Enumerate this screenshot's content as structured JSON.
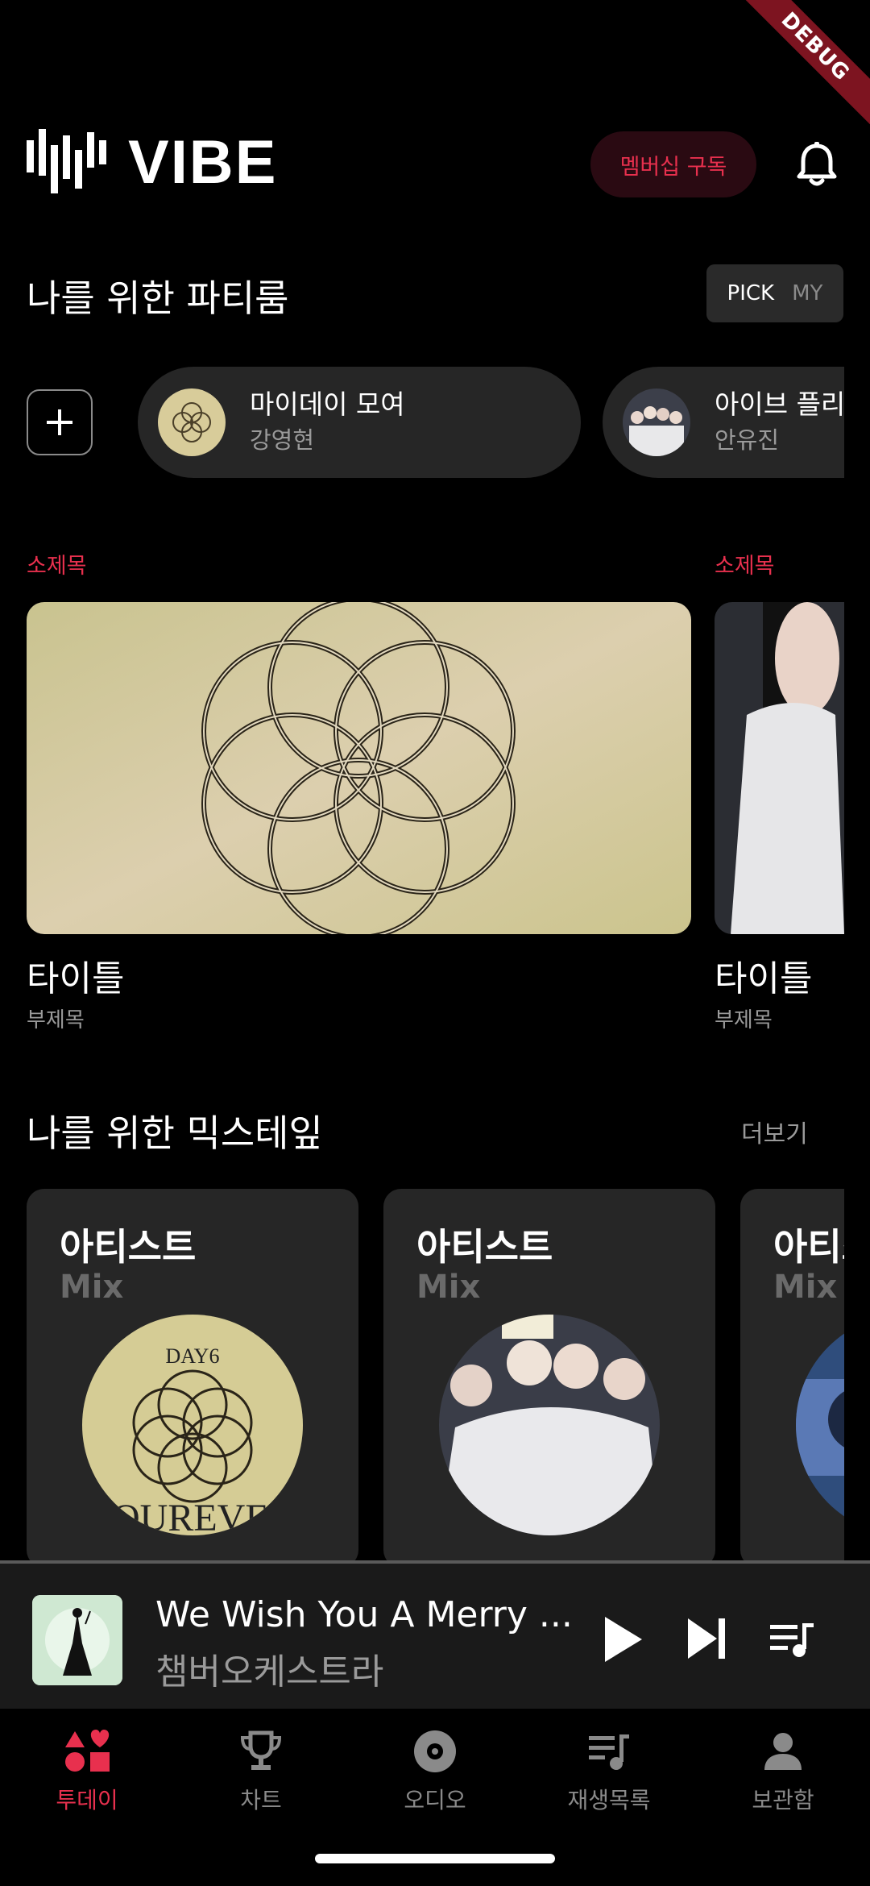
{
  "debug_badge": "DEBUG",
  "header": {
    "logo_text": "VIBE",
    "membership_button": "멤버십 구독"
  },
  "party": {
    "title": "나를 위한 파티룸",
    "toggle": {
      "pick": "PICK",
      "my": "MY"
    },
    "rooms": [
      {
        "title": "마이데이 모여",
        "host": "강영현"
      },
      {
        "title": "아이브 플리",
        "host": "안유진"
      }
    ]
  },
  "featured": [
    {
      "kicker": "소제목",
      "title": "타이틀",
      "subtitle": "부제목"
    },
    {
      "kicker": "소제목",
      "title": "타이틀",
      "subtitle": "부제목"
    }
  ],
  "mixtape": {
    "title": "나를 위한 믹스테잎",
    "more": "더보기",
    "cards": [
      {
        "artist": "아티스트",
        "label": "Mix"
      },
      {
        "artist": "아티스트",
        "label": "Mix"
      },
      {
        "artist": "아티스트",
        "label": "Mix"
      }
    ]
  },
  "album_text": {
    "day6": "DAY6",
    "fourever": "FOUREVER"
  },
  "player": {
    "song": "We Wish You A Merry ...",
    "artist": "챔버오케스트라"
  },
  "nav": [
    {
      "label": "투데이",
      "icon": "today-shapes-icon",
      "active": true
    },
    {
      "label": "차트",
      "icon": "trophy-icon",
      "active": false
    },
    {
      "label": "오디오",
      "icon": "disc-icon",
      "active": false
    },
    {
      "label": "재생목록",
      "icon": "playlist-icon",
      "active": false
    },
    {
      "label": "보관함",
      "icon": "person-icon",
      "active": false
    }
  ],
  "colors": {
    "accent": "#e8304e",
    "background": "#000000",
    "card": "#262626"
  }
}
